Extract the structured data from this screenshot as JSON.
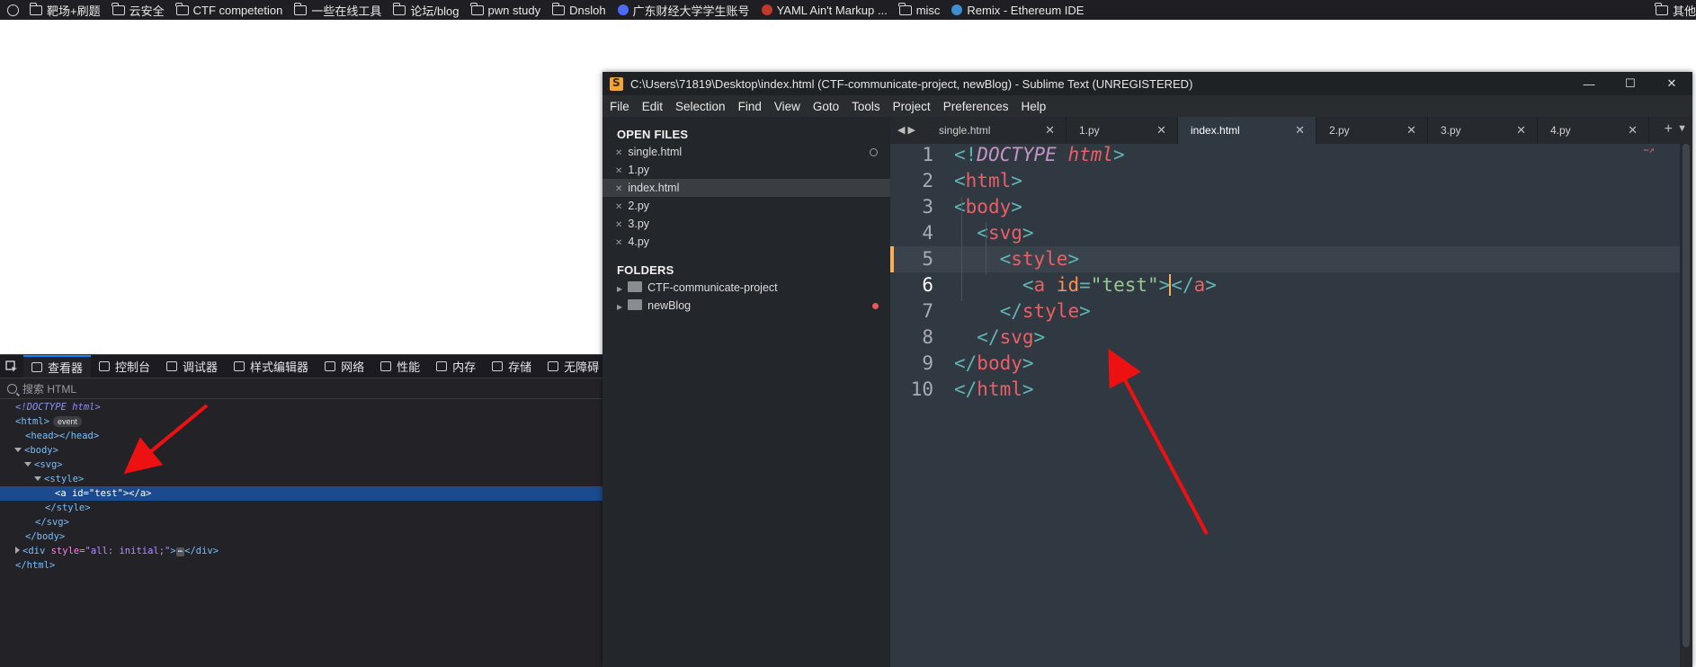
{
  "bookmarks": [
    {
      "label": "靶场+刷题",
      "icon": "folder-icon"
    },
    {
      "label": "云安全",
      "icon": "folder-icon"
    },
    {
      "label": "CTF competetion",
      "icon": "folder-icon"
    },
    {
      "label": "一些在线工具",
      "icon": "folder-icon"
    },
    {
      "label": "论坛/blog",
      "icon": "folder-icon"
    },
    {
      "label": "pwn study",
      "icon": "folder-icon"
    },
    {
      "label": "Dnsloh",
      "icon": "folder-icon"
    },
    {
      "label": "广东财经大学学生账号",
      "icon": "site-icon"
    },
    {
      "label": "YAML Ain't Markup ...",
      "icon": "site-icon"
    },
    {
      "label": "misc",
      "icon": "folder-icon"
    },
    {
      "label": "Remix - Ethereum IDE",
      "icon": "site-icon"
    }
  ],
  "bookmarks_other": "其他",
  "devtools": {
    "tabs": [
      {
        "label": "查看器",
        "icon": "inspector-icon"
      },
      {
        "label": "控制台",
        "icon": "console-icon"
      },
      {
        "label": "调试器",
        "icon": "debugger-icon"
      },
      {
        "label": "样式编辑器",
        "icon": "style-editor-icon"
      },
      {
        "label": "网络",
        "icon": "network-icon"
      },
      {
        "label": "性能",
        "icon": "performance-icon"
      },
      {
        "label": "内存",
        "icon": "memory-icon"
      },
      {
        "label": "存储",
        "icon": "storage-icon"
      },
      {
        "label": "无障碍",
        "icon": "accessibility-icon"
      }
    ],
    "search_placeholder": "搜索 HTML",
    "tree": {
      "doctype": "<!DOCTYPE html>",
      "html_open": "<html>",
      "event_badge": "event",
      "head": "<head></head>",
      "body_open": "<body>",
      "svg_open": "<svg>",
      "style_open": "<style>",
      "a_tag": "<a id=\"test\"></a>",
      "style_close": "</style>",
      "svg_close": "</svg>",
      "body_close": "</body>",
      "div_open": "<div ",
      "div_attr": "style=",
      "div_val": "\"all: initial;\"",
      "div_rest": ">",
      "ellipsis": "⋯",
      "div_close": "</div>",
      "html_close": "</html>"
    }
  },
  "sublime": {
    "title": "C:\\Users\\71819\\Desktop\\index.html (CTF-communicate-project, newBlog) - Sublime Text (UNREGISTERED)",
    "menu": [
      "File",
      "Edit",
      "Selection",
      "Find",
      "View",
      "Goto",
      "Tools",
      "Project",
      "Preferences",
      "Help"
    ],
    "open_files_header": "OPEN FILES",
    "open_files": [
      "single.html",
      "1.py",
      "index.html",
      "2.py",
      "3.py",
      "4.py"
    ],
    "active_file": "index.html",
    "folders_header": "FOLDERS",
    "folders": [
      "CTF-communicate-project",
      "newBlog"
    ],
    "tabs": [
      "single.html",
      "1.py",
      "index.html",
      "2.py",
      "3.py",
      "4.py"
    ],
    "line_numbers": [
      "1",
      "2",
      "3",
      "4",
      "5",
      "6",
      "7",
      "8",
      "9",
      "10"
    ],
    "current_line": 6
  },
  "colors": {
    "accent_blue": "#0a84ff",
    "arrow_red": "#ee1111",
    "dirty_dot": "#e85a5a"
  }
}
